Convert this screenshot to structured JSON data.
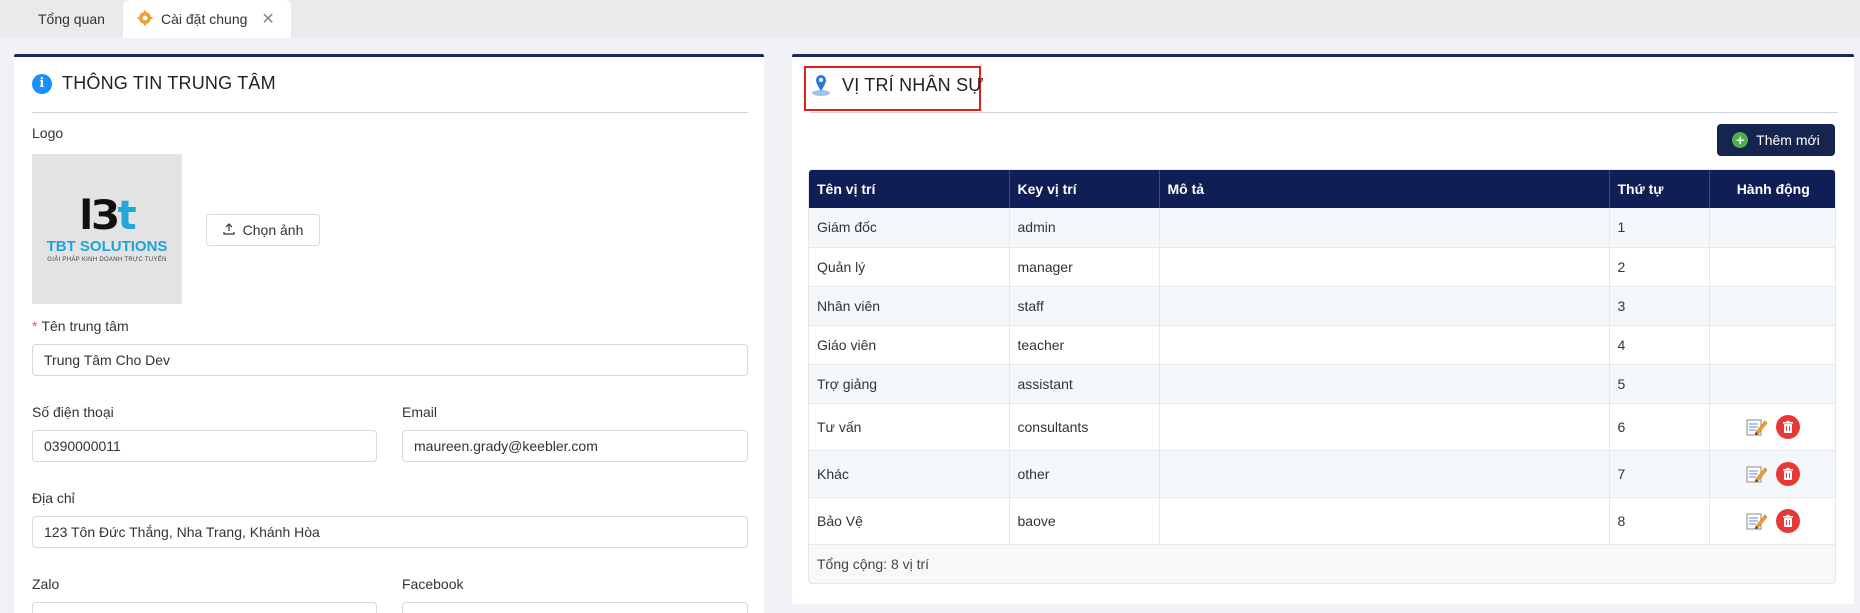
{
  "tabs": [
    {
      "label": "Tổng quan",
      "icon": "dashboard-grid-icon"
    },
    {
      "label": "Cài đặt chung",
      "icon": "settings-puzzle-icon",
      "close": "✕"
    }
  ],
  "left_panel": {
    "title": "THÔNG TIN TRUNG TÂM",
    "logo_label": "Logo",
    "logo": {
      "mark_a": "lЗ",
      "mark_b": "t",
      "name": "TBT SOLUTIONS",
      "tagline": "GIẢI PHÁP KINH DOANH TRỰC TUYẾN"
    },
    "choose_image": "Chọn ảnh",
    "center_name_label": "Tên trung tâm",
    "center_name_value": "Trung Tâm Cho Dev",
    "phone_label": "Số điện thoại",
    "phone_value": "0390000011",
    "email_label": "Email",
    "email_value": "maureen.grady@keebler.com",
    "address_label": "Địa chỉ",
    "address_value": "123 Tôn Đức Thắng, Nha Trang, Khánh Hòa",
    "zalo_label": "Zalo",
    "facebook_label": "Facebook"
  },
  "right_panel": {
    "title": "VỊ TRÍ NHÂN SỰ",
    "add_button": "Thêm mới",
    "columns": [
      "Tên vị trí",
      "Key vị trí",
      "Mô tả",
      "Thứ tự",
      "Hành động"
    ],
    "rows": [
      {
        "name": "Giám đốc",
        "key": "admin",
        "desc": "",
        "order": "1",
        "actions": false
      },
      {
        "name": "Quản lý",
        "key": "manager",
        "desc": "",
        "order": "2",
        "actions": false
      },
      {
        "name": "Nhân viên",
        "key": "staff",
        "desc": "",
        "order": "3",
        "actions": false
      },
      {
        "name": "Giáo viên",
        "key": "teacher",
        "desc": "",
        "order": "4",
        "actions": false
      },
      {
        "name": "Trợ giảng",
        "key": "assistant",
        "desc": "",
        "order": "5",
        "actions": false
      },
      {
        "name": "Tư vấn",
        "key": "consultants",
        "desc": "",
        "order": "6",
        "actions": true
      },
      {
        "name": "Khác",
        "key": "other",
        "desc": "",
        "order": "7",
        "actions": true
      },
      {
        "name": "Bảo Vệ",
        "key": "baove",
        "desc": "",
        "order": "8",
        "actions": true
      }
    ],
    "footer": "Tổng cộng: 8 vị trí"
  },
  "colors": {
    "header_bg": "#0f1f56",
    "accent_navy": "#16254f",
    "danger": "#e53935",
    "info": "#1890ff"
  }
}
